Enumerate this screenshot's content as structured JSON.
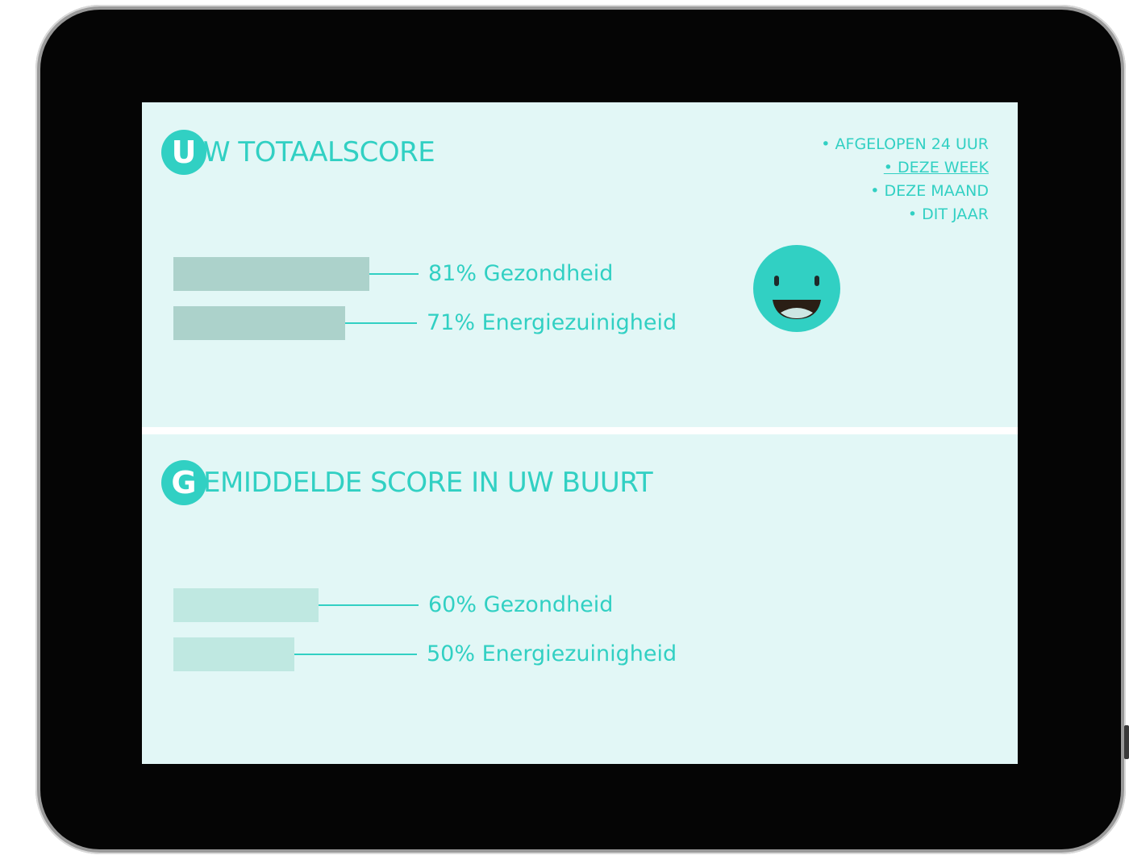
{
  "colors": {
    "accent": "#31d0c3",
    "panel_bg": "#e2f7f6",
    "bar_user": "#acd2cb",
    "bar_area": "#bfe8e1",
    "frame": "#050505"
  },
  "user_score": {
    "letter": "U",
    "title": "W TOTAALSCORE",
    "periods": [
      {
        "label": "• AFGELOPEN 24 UUR",
        "active": false
      },
      {
        "label": "• DEZE WEEK",
        "active": true
      },
      {
        "label": "• DEZE MAAND",
        "active": false
      },
      {
        "label": "• DIT JAAR",
        "active": false
      }
    ],
    "bars": [
      {
        "value": 81,
        "label": "81% Gezondheid"
      },
      {
        "value": 71,
        "label": "71% Energiezuinigheid"
      }
    ],
    "mood_icon": "smiley-face-icon"
  },
  "area_score": {
    "letter": "G",
    "title": "EMIDDELDE SCORE IN UW BUURT",
    "bars": [
      {
        "value": 60,
        "label": "60% Gezondheid"
      },
      {
        "value": 50,
        "label": "50% Energiezuinigheid"
      }
    ]
  }
}
